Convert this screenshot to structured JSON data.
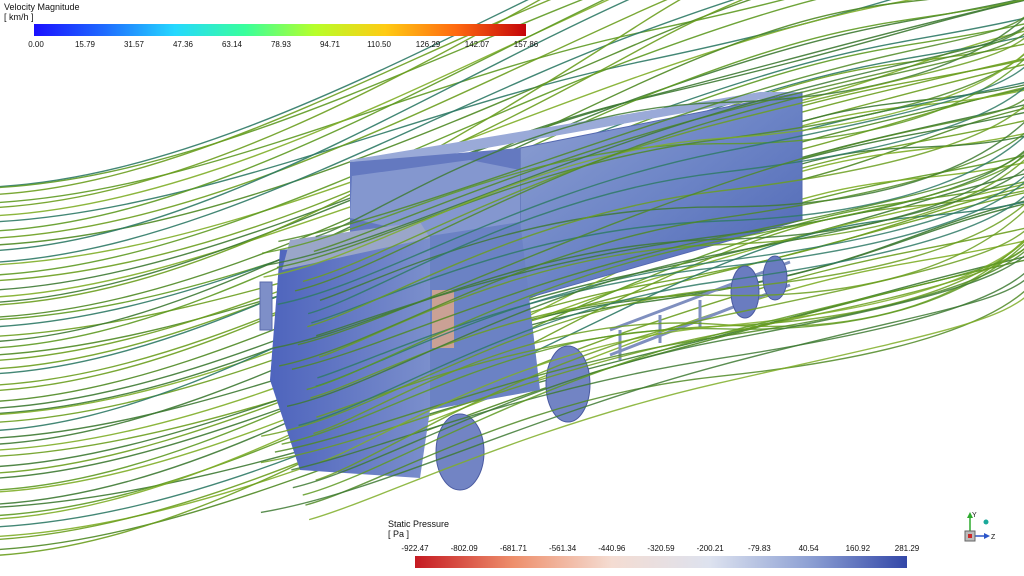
{
  "velocity_legend": {
    "title": "Velocity Magnitude",
    "unit": "[ km/h ]",
    "ticks": [
      "0.00",
      "15.79",
      "31.57",
      "47.36",
      "63.14",
      "78.93",
      "94.71",
      "110.50",
      "126.29",
      "142.07",
      "157.86"
    ],
    "colors": [
      "#1a10ff",
      "#1f6bff",
      "#25d8ff",
      "#39ff9c",
      "#b7ff2a",
      "#ffcb13",
      "#ff6a10",
      "#c4050a"
    ]
  },
  "pressure_legend": {
    "title": "Static Pressure",
    "unit": "[ Pa ]",
    "ticks": [
      "-922.47",
      "-802.09",
      "-681.71",
      "-561.34",
      "-440.96",
      "-320.59",
      "-200.21",
      "-79.83",
      "40.54",
      "160.92",
      "281.29"
    ],
    "colors": [
      "#c51a22",
      "#ee8f6c",
      "#f4dcd2",
      "#dde2ef",
      "#8ea1d4",
      "#3347a8"
    ]
  },
  "scene": {
    "subject": "truck",
    "streamline_color": "#4f8a24",
    "body_color": "#6f86c4"
  },
  "axis_triad": {
    "y_label": "Y",
    "z_label": "Z"
  }
}
